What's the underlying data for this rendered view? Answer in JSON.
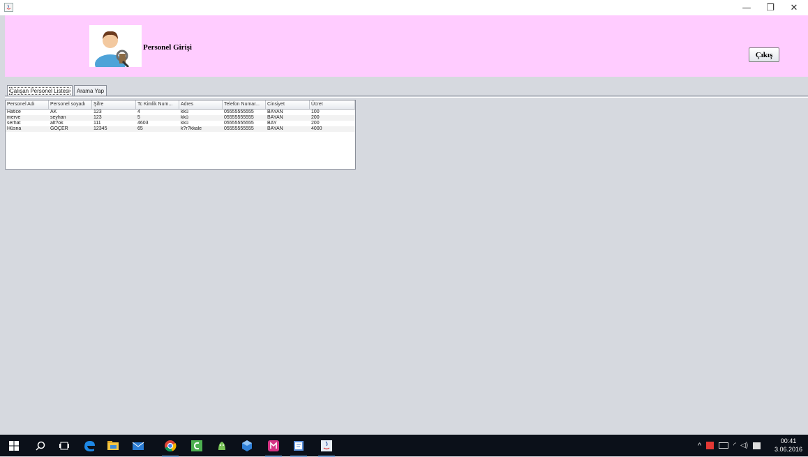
{
  "window": {
    "minimize_glyph": "—",
    "maximize_glyph": "❐",
    "close_glyph": "✕"
  },
  "header": {
    "title": "Personel Girişi",
    "exit_label": "Çıkış",
    "background": "#ffccff"
  },
  "tabs": [
    {
      "label": "Çalışan Personel Listesi",
      "active": true
    },
    {
      "label": "Arama Yap",
      "active": false
    }
  ],
  "table": {
    "columns": [
      "Personel Adı",
      "Personel soyadı",
      "Şifre",
      "Tc Kimlik Num...",
      "Adres",
      "Telefon Numar...",
      "Cinsiyet",
      "Ücret"
    ],
    "rows": [
      [
        "Hatice",
        "AK",
        "123",
        "4",
        "kkü",
        "05555555555",
        "BAYAN",
        "100"
      ],
      [
        "merve",
        "seyhan",
        "123",
        "5",
        "kkü",
        "05555555555",
        "BAYAN",
        "200"
      ],
      [
        "serhat",
        "alt?ok",
        "111",
        "4603",
        "kkü",
        "05555555555",
        "BAY",
        "200"
      ],
      [
        "Hüsna",
        "GÖÇER",
        "12345",
        "65",
        "k?r?kkale",
        "05555555555",
        "BAYAN",
        "4000"
      ]
    ]
  },
  "taskbar": {
    "apps": [
      "windows-start-icon",
      "search-icon",
      "task-view-icon",
      "edge-icon",
      "file-explorer-icon",
      "mail-icon",
      "chrome-icon",
      "camtasia-icon",
      "android-studio-icon",
      "virtualbox-icon",
      "app-m-icon",
      "notepad-icon",
      "java-icon"
    ],
    "time": "00:41",
    "date": "3.06.2016"
  }
}
